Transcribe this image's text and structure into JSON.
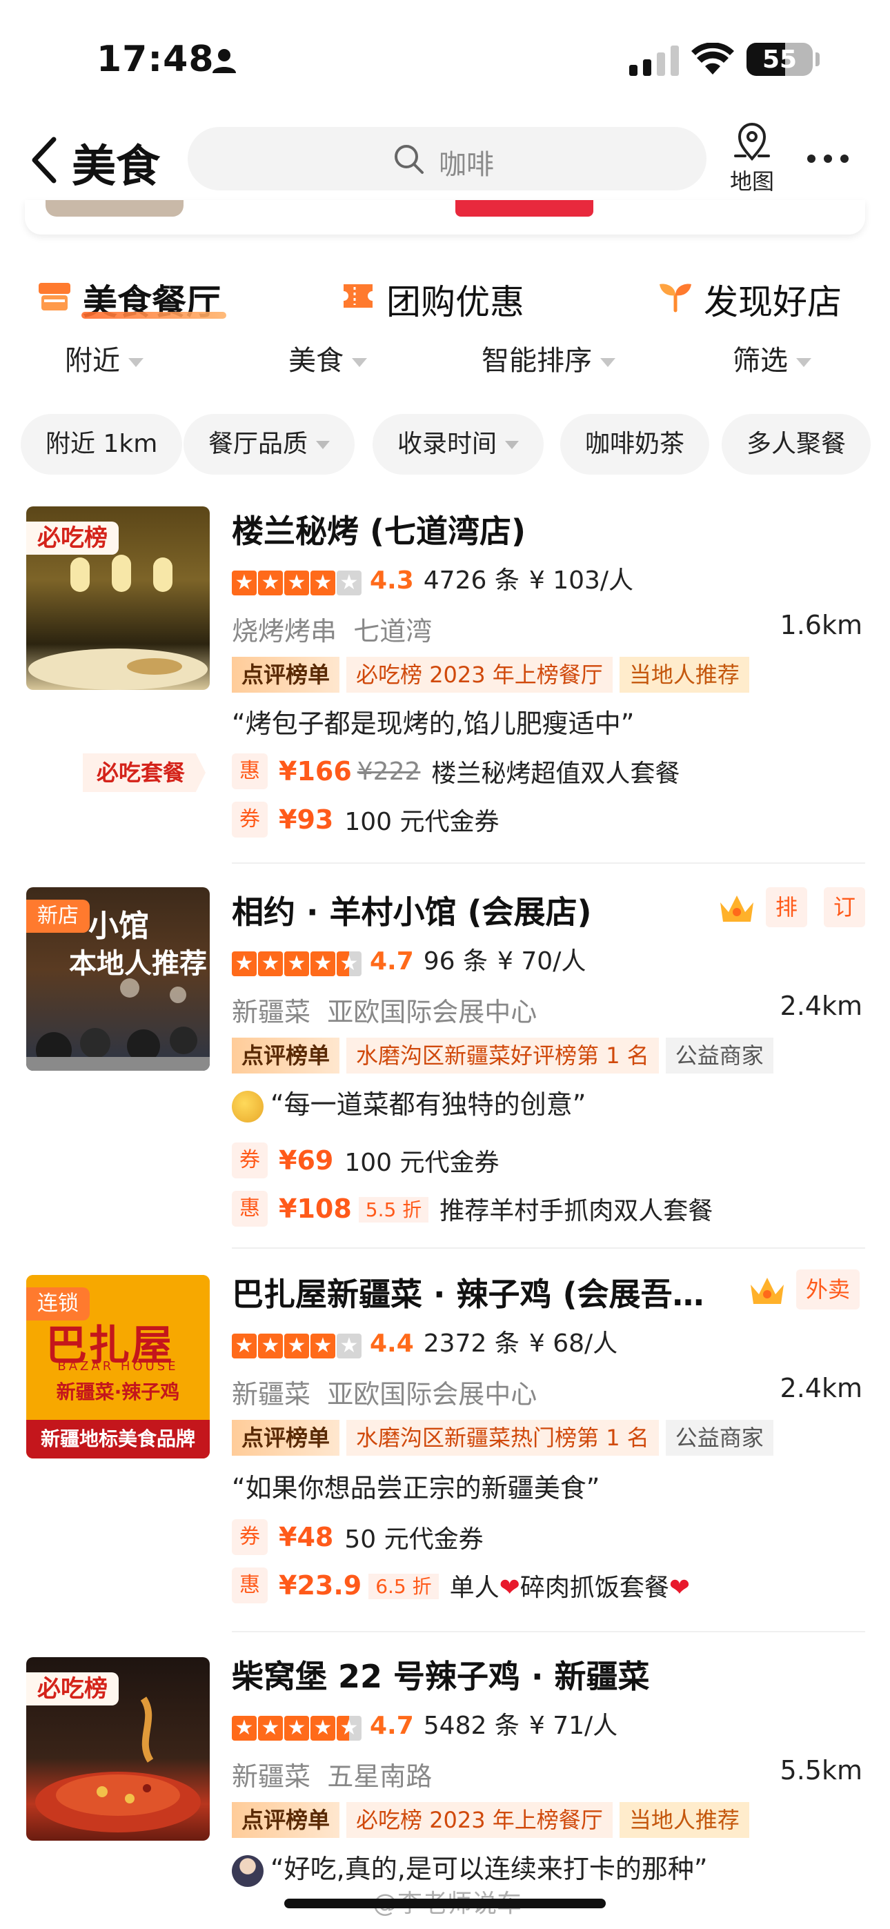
{
  "status": {
    "time": "17:48",
    "battery": "55"
  },
  "nav": {
    "title": "美食",
    "search_placeholder": "咖啡",
    "map_label": "地图"
  },
  "categories": [
    {
      "label": "美食餐厅",
      "icon": "shop-icon"
    },
    {
      "label": "团购优惠",
      "icon": "coupon-icon"
    },
    {
      "label": "发现好店",
      "icon": "sprout-icon"
    }
  ],
  "sorts": [
    "附近",
    "美食",
    "智能排序",
    "筛选"
  ],
  "chips": [
    "附近 1km",
    "餐厅品质",
    "收录时间",
    "咖啡奶茶",
    "多人聚餐"
  ],
  "listings": [
    {
      "badge": "必吃榜",
      "name": "楼兰秘烤 (七道湾店)",
      "rating": 4.3,
      "score": "4.3",
      "reviews": "4726 条",
      "price": "¥ 103/人",
      "cuisine": "烧烤烤串",
      "area": "七道湾",
      "distance": "1.6km",
      "tags": [
        "点评榜单",
        "必吃榜 2023 年上榜餐厅",
        "当地人推荐"
      ],
      "quote": "“烤包子都是现烤的,馅儿肥瘦适中”",
      "set_label": "必吃套餐",
      "deals": [
        {
          "type": "惠",
          "price": "¥166",
          "old": "¥222",
          "name": "楼兰秘烤超值双人套餐"
        },
        {
          "type": "券",
          "price": "¥93",
          "name": "100 元代金券"
        }
      ]
    },
    {
      "badge": "新店",
      "thumb_text_1": "小馆",
      "thumb_text_2": "本地人推荐",
      "name": "相约 · 羊村小馆 (会展店)",
      "rating": 4.7,
      "score": "4.7",
      "reviews": "96 条",
      "price": "¥ 70/人",
      "cuisine": "新疆菜",
      "area": "亚欧国际会展中心",
      "distance": "2.4km",
      "tags": [
        "点评榜单",
        "水磨沟区新疆菜好评榜第 1 名",
        "公益商家"
      ],
      "quote": "“每一道菜都有独特的创意”",
      "right_tags": [
        "排",
        "订"
      ],
      "deals": [
        {
          "type": "券",
          "price": "¥69",
          "name": "100 元代金券"
        },
        {
          "type": "惠",
          "price": "¥108",
          "discount": "5.5 折",
          "name": "推荐羊村手抓肉双人套餐"
        }
      ]
    },
    {
      "badge": "连锁",
      "logo_main": "巴扎屋",
      "logo_sub": "BAZAR HOUSE",
      "logo_line": "新疆菜·辣子鸡",
      "logo_footer": "新疆地标美食品牌",
      "name": "巴扎屋新疆菜 · 辣子鸡 (会展吾…",
      "rating": 4.4,
      "score": "4.4",
      "reviews": "2372 条",
      "price": "¥ 68/人",
      "cuisine": "新疆菜",
      "area": "亚欧国际会展中心",
      "distance": "2.4km",
      "tags": [
        "点评榜单",
        "水磨沟区新疆菜热门榜第 1 名",
        "公益商家"
      ],
      "quote": "“如果你想品尝正宗的新疆美食”",
      "right_tags": [
        "外卖"
      ],
      "deals": [
        {
          "type": "券",
          "price": "¥48",
          "name": "50 元代金券"
        },
        {
          "type": "惠",
          "price": "¥23.9",
          "discount": "6.5 折",
          "name_a": "单人",
          "name_b": "碎肉抓饭套餐"
        }
      ]
    },
    {
      "badge": "必吃榜",
      "name": "柴窝堡 22 号辣子鸡 · 新疆菜",
      "rating": 4.7,
      "score": "4.7",
      "reviews": "5482 条",
      "price": "¥ 71/人",
      "cuisine": "新疆菜",
      "area": "五星南路",
      "distance": "5.5km",
      "tags": [
        "点评榜单",
        "必吃榜 2023 年上榜餐厅",
        "当地人推荐"
      ],
      "quote": "“好吃,真的,是可以连续来打卡的那种”"
    }
  ],
  "watermark": "@李老师说车",
  "colors": {
    "accent": "#ff6a1a",
    "price": "#ff5a1a"
  }
}
